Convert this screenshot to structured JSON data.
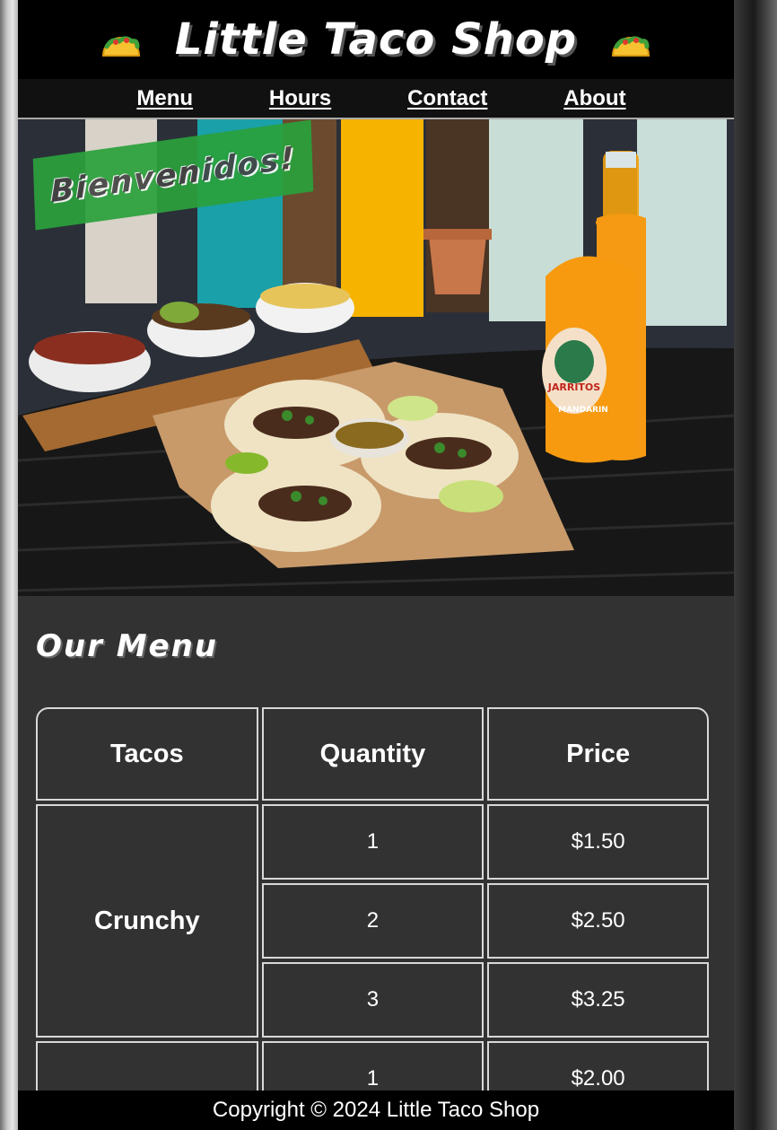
{
  "header": {
    "title": "Little Taco Shop",
    "left_icon": "taco-icon",
    "right_icon": "taco-icon"
  },
  "nav": {
    "items": [
      {
        "label": "Menu"
      },
      {
        "label": "Hours"
      },
      {
        "label": "Contact"
      },
      {
        "label": "About"
      }
    ]
  },
  "hero": {
    "banner": "Bienvenidos!",
    "bottle_brand": "JARRITOS",
    "bottle_flavor": "MANDARIN"
  },
  "menu": {
    "heading": "Our Menu",
    "columns": [
      "Tacos",
      "Quantity",
      "Price"
    ],
    "rows": [
      {
        "type": "Crunchy",
        "quantity": "1",
        "price": "$1.50"
      },
      {
        "quantity": "2",
        "price": "$2.50"
      },
      {
        "quantity": "3",
        "price": "$3.25"
      },
      {
        "type": "",
        "quantity": "1",
        "price": "$2.00"
      }
    ]
  },
  "footer": {
    "copyright": "Copyright © 2024 Little Taco Shop"
  },
  "colors": {
    "page_bg": "#323232",
    "header_bg": "#000000",
    "banner_green": "#2aa13c",
    "accent_orange": "#f5a300"
  }
}
